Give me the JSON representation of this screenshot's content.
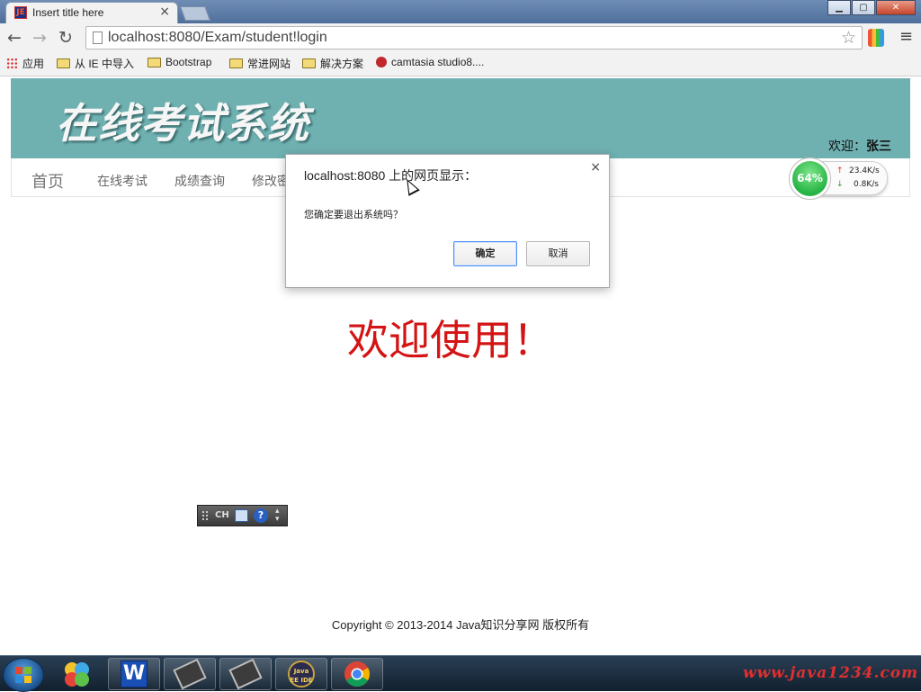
{
  "browser": {
    "tab_title": "Insert title here",
    "tab_close": "×",
    "window_buttons": {
      "minimize": "▁",
      "maximize": "▢",
      "close": "✕"
    },
    "back": "←",
    "forward": "→",
    "reload": "↻",
    "url": "localhost:8080/Exam/student!login",
    "star": "☆",
    "menu": "≡",
    "favicon_text": "JE",
    "bookmarks": [
      {
        "label": "应用",
        "icon": "apps-grid-icon"
      },
      {
        "label": "从 IE 中导入",
        "icon": "folder-icon"
      },
      {
        "label": "Bootstrap",
        "icon": "folder-icon"
      },
      {
        "label": "常进网站",
        "icon": "folder-icon"
      },
      {
        "label": "解决方案",
        "icon": "folder-icon"
      },
      {
        "label": "camtasia studio8....",
        "icon": "red-app-icon"
      }
    ]
  },
  "site": {
    "logo": "在线考试系统",
    "welcome_prefix": "欢迎：",
    "user_name": "张三",
    "nav": {
      "home": "首页",
      "links": [
        "在线考试",
        "成绩查询",
        "修改密"
      ]
    },
    "welcome_message": "欢迎使用！",
    "footer": "Copyright © 2013-2014 Java知识分享网 版权所有",
    "header_color": "#6fb0b1",
    "accent_red": "#d41414"
  },
  "speed_widget": {
    "percent": "64%",
    "upload": "23.4K/s",
    "download": "0.8K/s",
    "up_arrow": "↑",
    "down_arrow": "↓"
  },
  "ime_bar": {
    "lang": "CH",
    "help": "?"
  },
  "dialog": {
    "title": "localhost:8080 上的网页显示：",
    "message": "您确定要退出系统吗？",
    "ok": "确定",
    "cancel": "取消",
    "close": "×"
  },
  "taskbar": {
    "watermark": "www.java1234.com",
    "apps": [
      "start-icon",
      "paint-icon",
      "wps-writer-icon",
      "terminal-icon",
      "terminal-icon",
      "javaee-ide-icon",
      "chrome-icon"
    ],
    "wps_letter": "W",
    "ide_text": "Java EE IDE"
  }
}
